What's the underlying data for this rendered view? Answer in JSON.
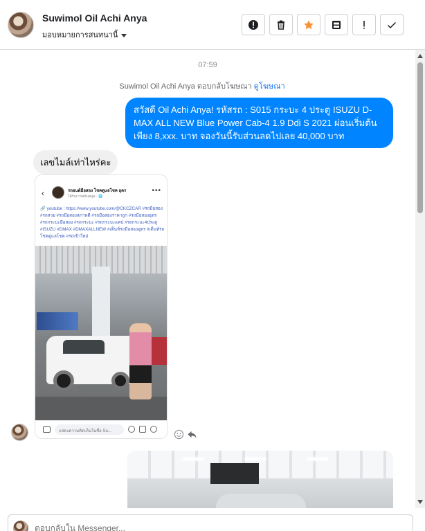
{
  "header": {
    "contact_name": "Suwimol Oil Achi Anya",
    "assign_label": "มอบหมายการสนทนานี้",
    "actions": [
      {
        "icon": "alert-circle-icon",
        "label": "!"
      },
      {
        "icon": "trash-icon",
        "label": ""
      },
      {
        "icon": "star-icon",
        "label": ""
      },
      {
        "icon": "archive-icon",
        "label": ""
      },
      {
        "icon": "exclamation-icon",
        "label": "!"
      },
      {
        "icon": "check-icon",
        "label": ""
      }
    ],
    "star_color": "#f7923a"
  },
  "thread": {
    "timestamp": "07:59",
    "system_note": "Suwimol Oil Achi Anya ตอบกลับโฆษณา",
    "system_note_link": "ดูโฆษณา",
    "outgoing_message": "สวัสดี Oil Achi Anya!  รหัสรถ : S015 กระบะ 4 ประตู ISUZU D-MAX ALL NEW Blue Power Cab-4 1.9 Ddi S 2021 ผ่อนเริ่มต้นเพียง 8,xxx. บาท จองวันนี้รับส่วนลดไปเลย 40,000 บาท",
    "incoming_message": "เลขไมล์เท่าไหร่คะ",
    "screenshot": {
      "page_name": "รถยนต์มือสอง โชคดูแลโชค อุดร",
      "page_sub": "ได้รับการสนับสนุน · 🌐",
      "post_text": "🔗 youtube : https://www.youtube.com/@CKCZCAR #รถมือสอง #รถสวย #รถมือสองสภาพดี #รถมือสองราคาถูก #รถมือสองอุดร #รถกระบะมือสอง #รถกระบะ #รถกระบะแคป #รถกระบะ4ประตู #ISUZU #DMAX #DMAXALLNEW #เต็นท์รถมือสองอุดร #เต็นท์รถโชคดูแลโชค #รถเข้าใหม่",
      "comment_placeholder": "แสดงความคิดเห็นในชื่อ Su..."
    }
  },
  "composer": {
    "placeholder": "ตอบกลับใน Messenger..."
  },
  "colors": {
    "outgoing_bubble": "#0084ff",
    "incoming_bubble": "#f0f0f0",
    "link": "#1877f2"
  }
}
